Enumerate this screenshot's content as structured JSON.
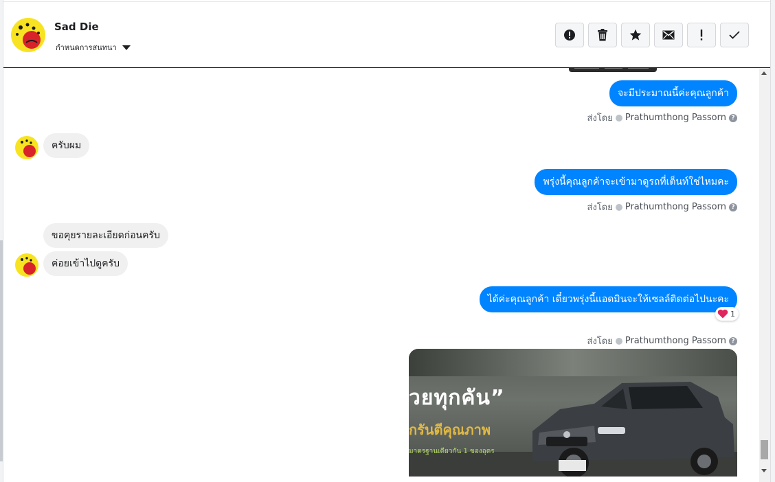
{
  "header": {
    "contact_name": "Sad Die",
    "subtitle": "กำหนดการสนทนา",
    "toolbar": [
      {
        "icon": "alert-circle-icon",
        "label": "Mark as spam"
      },
      {
        "icon": "trash-icon",
        "label": "Delete"
      },
      {
        "icon": "star-icon",
        "label": "Star"
      },
      {
        "icon": "envelope-icon",
        "label": "Mark as unread"
      },
      {
        "icon": "exclamation-icon",
        "label": "Follow up"
      },
      {
        "icon": "check-icon",
        "label": "Mark as done"
      }
    ]
  },
  "messages": {
    "m1": "จะมีประมาณนี้ค่ะคุณลูกค้า",
    "m2": "ครับผม",
    "m3": "พรุ่งนี้คุณลูกค้าจะเข้ามาดูรถที่เต็นท์ใช่ไหมคะ",
    "m4": "ขอคุยรายละเอียดก่อนครับ",
    "m5": "ค่อยเข้าไปดูครับ",
    "m6": "ได้ค่ะคุณลูกค้า เดี๋ยวพรุ่งนี้แอดมินจะให้เซลล์ติดต่อไปนะคะ"
  },
  "sent_by": {
    "prefix": "ส่งโดย",
    "agent": "Prathumthong Passorn",
    "help": "?"
  },
  "reaction": {
    "emoji": "heart-icon",
    "count": "1",
    "color": "#e0245e"
  },
  "promo": {
    "headline": "วยทุกคัน”",
    "tagline": "กรันตีคุณภาพ",
    "smallline": "มาตรฐานเดียวกัน 1 ของอุดร"
  },
  "colors": {
    "outgoing_bubble": "#0084ff",
    "incoming_bubble": "#f0f0f0"
  }
}
